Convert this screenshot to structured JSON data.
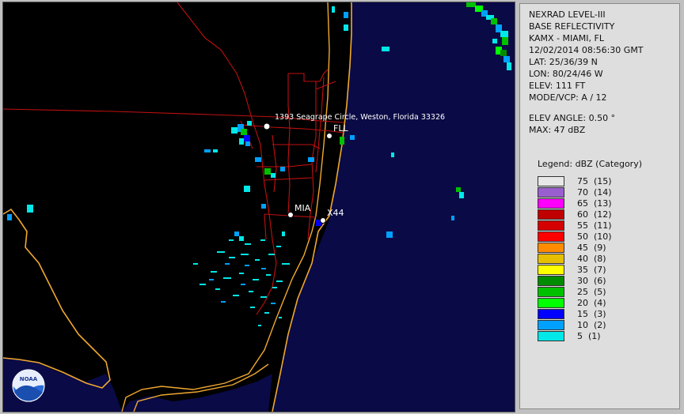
{
  "info": {
    "product": "NEXRAD LEVEL-III",
    "type": "BASE REFLECTIVITY",
    "station": "KAMX - MIAMI, FL",
    "datetime": "12/02/2014 08:56:30 GMT",
    "lat": "LAT: 25/36/39 N",
    "lon": "LON: 80/24/46 W",
    "elev": "ELEV: 111 FT",
    "mode": "MODE/VCP: A / 12",
    "elev_angle": "ELEV ANGLE: 0.50 °",
    "max": "MAX: 47 dBZ"
  },
  "legend": {
    "title": "Legend: dBZ (Category)",
    "items": [
      {
        "label": "75  (15)",
        "color": "#e8e8e8"
      },
      {
        "label": "70  (14)",
        "color": "#9a5fcf"
      },
      {
        "label": "65  (13)",
        "color": "#ff00ff"
      },
      {
        "label": "60  (12)",
        "color": "#c00000"
      },
      {
        "label": "55  (11)",
        "color": "#d40000"
      },
      {
        "label": "50  (10)",
        "color": "#ff0000"
      },
      {
        "label": "45  (9)",
        "color": "#ff8c00"
      },
      {
        "label": "40  (8)",
        "color": "#e6c000"
      },
      {
        "label": "35  (7)",
        "color": "#ffff00"
      },
      {
        "label": "30  (6)",
        "color": "#008c00"
      },
      {
        "label": "25  (5)",
        "color": "#00c000"
      },
      {
        "label": "20  (4)",
        "color": "#00ff00"
      },
      {
        "label": "15  (3)",
        "color": "#0000ff"
      },
      {
        "label": "10  (2)",
        "color": "#00a0ff"
      },
      {
        "label": "5  (1)",
        "color": "#00e8e8"
      }
    ]
  },
  "map": {
    "markers": {
      "address": "1393 Seagrape Circle, Weston, Florida 33326",
      "fll": "FLL",
      "mia": "MIA",
      "x44": "X44"
    },
    "logo_text": "NOAA",
    "colors": {
      "land": "#000000",
      "ocean": "#0a0a46",
      "coastline": "#f0a830",
      "roads": "#c01010"
    }
  }
}
